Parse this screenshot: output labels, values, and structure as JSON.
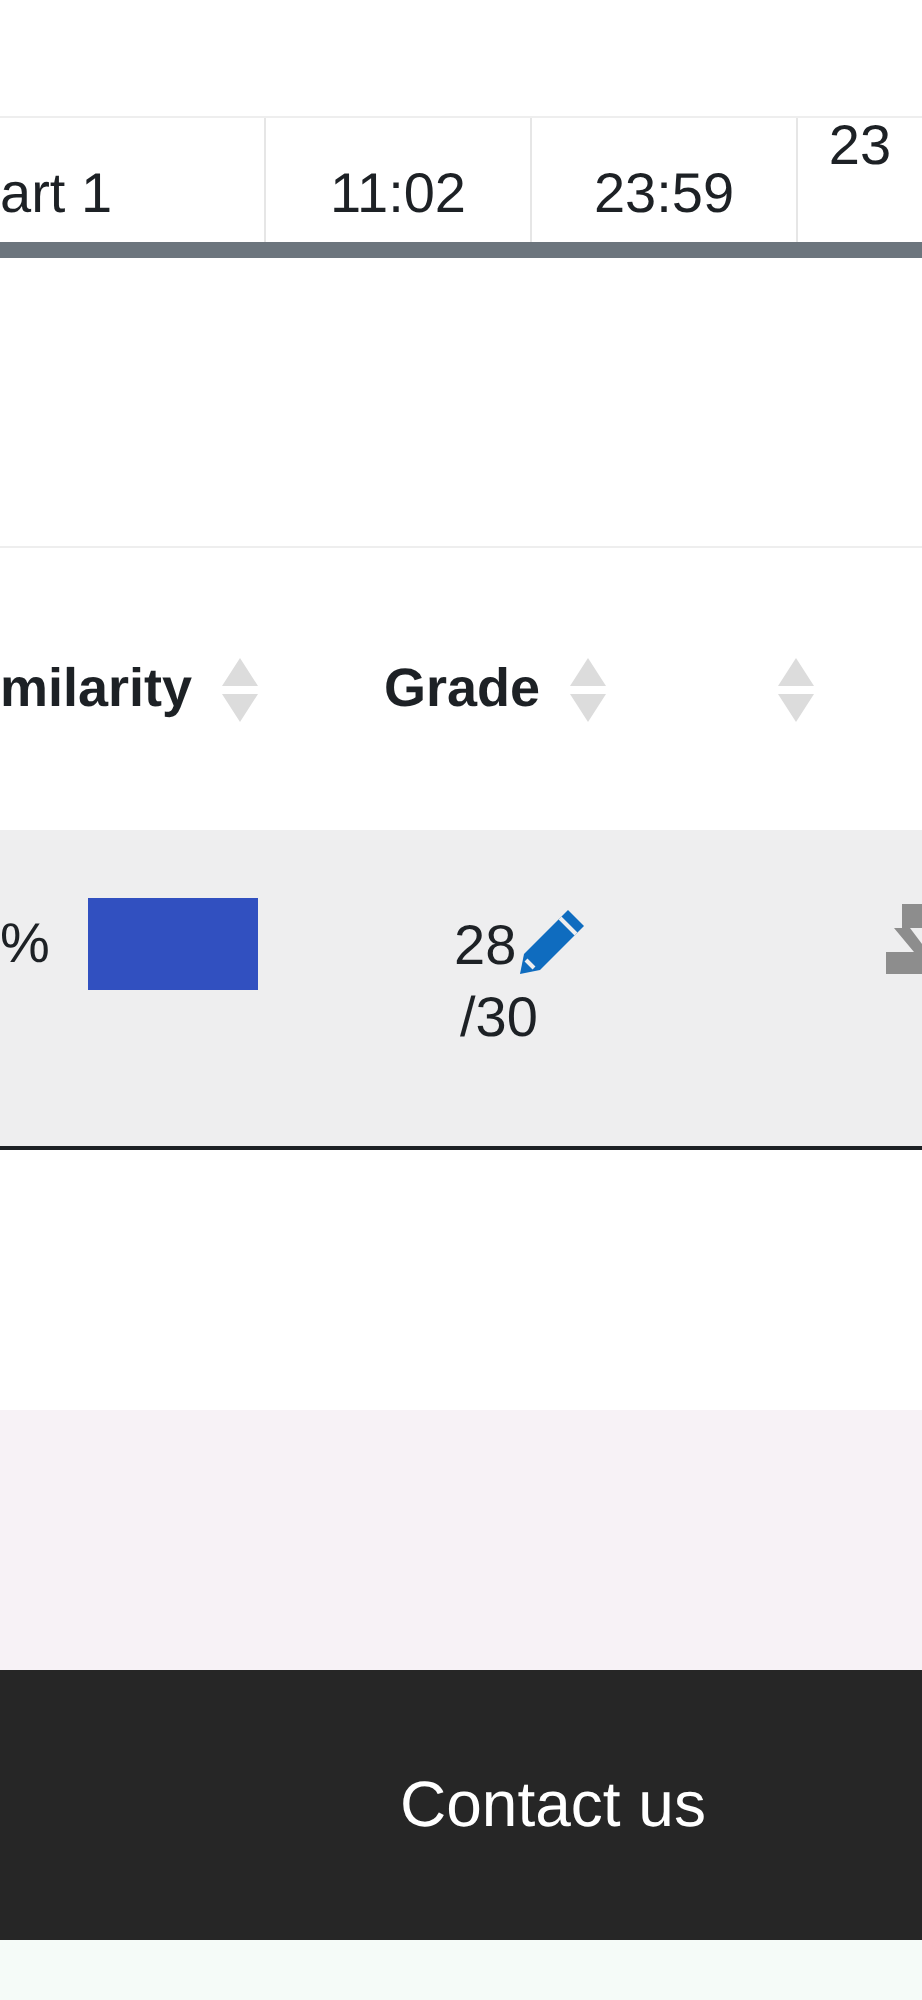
{
  "dates_row": {
    "cells": [
      "art 1",
      "11:02",
      "23:59",
      "23"
    ]
  },
  "table": {
    "columns": [
      {
        "label": "milarity",
        "sortable": true
      },
      {
        "label": "Grade",
        "sortable": true
      },
      {
        "sortable": true
      }
    ],
    "rows": [
      {
        "similarity": "%",
        "grade": "28",
        "grade_max": "/30"
      }
    ]
  },
  "footer": {
    "link": "Contact us"
  }
}
